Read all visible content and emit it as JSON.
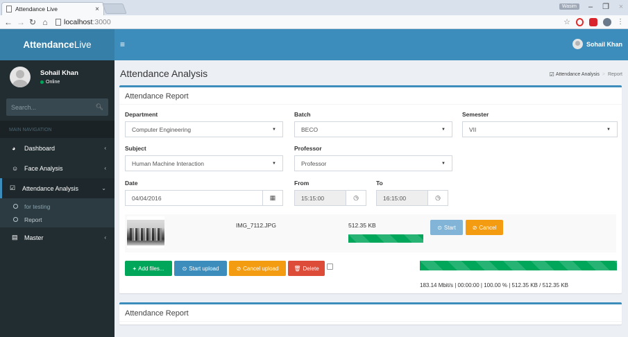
{
  "browser": {
    "tab_title": "Attendance Live",
    "tab_close": "×",
    "window_user": "Wasim",
    "url_host": "localhost",
    "url_port": ":3000"
  },
  "app": {
    "logo_bold": "Attendance",
    "logo_light": "Live",
    "header_user": "Sohail Khan"
  },
  "sidebar": {
    "user_name": "Sohail Khan",
    "user_status": "Online",
    "search_placeholder": "Search...",
    "nav_header": "MAIN NAVIGATION",
    "items": [
      {
        "label": "Dashboard",
        "icon": "dashboard-icon"
      },
      {
        "label": "Face Analysis",
        "icon": "face-icon"
      },
      {
        "label": "Attendance Analysis",
        "icon": "check-square-icon"
      },
      {
        "label": "Master",
        "icon": "database-icon"
      }
    ],
    "subitems": [
      {
        "label": "for testing"
      },
      {
        "label": "Report"
      }
    ]
  },
  "page": {
    "title": "Attendance Analysis",
    "breadcrumb_link": "Attendance Analysis",
    "breadcrumb_current": "Report"
  },
  "report": {
    "box_title": "Attendance Report",
    "department": {
      "label": "Department",
      "value": "Computer Engineering"
    },
    "batch": {
      "label": "Batch",
      "value": "BECO"
    },
    "semester": {
      "label": "Semester",
      "value": "VII"
    },
    "subject": {
      "label": "Subject",
      "value": "Human Machine Interaction"
    },
    "professor": {
      "label": "Professor",
      "value": "Professor"
    },
    "date": {
      "label": "Date",
      "value": "04/04/2016"
    },
    "from": {
      "label": "From",
      "value": "15:15:00"
    },
    "to": {
      "label": "To",
      "value": "16:15:00"
    }
  },
  "upload": {
    "file_name": "IMG_7112.JPG",
    "file_size": "512.35 KB",
    "file_progress": 1.0,
    "start_label": "Start",
    "cancel_label": "Cancel",
    "add_files_label": "Add files...",
    "start_upload_label": "Start upload",
    "cancel_upload_label": "Cancel upload",
    "delete_label": "Delete",
    "total_progress": 1.0,
    "progress_info": "183.14 Mbit/s | 00:00:00 | 100.00 % | 512.35 KB / 512.35 KB"
  },
  "box2": {
    "title": "Attendance Report"
  },
  "colors": {
    "header": "#3c8dbc",
    "logo": "#367fa9",
    "sidebar": "#222d32",
    "success": "#00a65a",
    "warning": "#f39c12",
    "danger": "#dd4b39"
  }
}
